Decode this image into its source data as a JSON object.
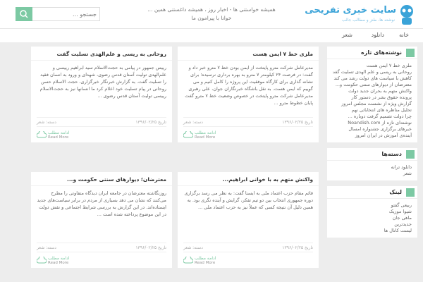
{
  "header": {
    "brand": "سایت خبری تفریحی",
    "brand_sub": "نوشته ها، طنز و مطالب جالب",
    "tagline_line1": "همیشه خواستنی ها - اخبار روز ، همیشه داغستنی همین ...",
    "tagline_line2": "خوانا با پیرامون ما",
    "search_placeholder": "جستجو ..."
  },
  "nav": {
    "items": [
      "خانه",
      "دانلود",
      "شعر"
    ]
  },
  "sidebar": {
    "recent_title": "نوشته‌های تازه",
    "recent_items": [
      "ملزی خط ۷ ایمن هست",
      "روحانی به ریسی و علم الهدی تسلیت گفت",
      "کاهش با سیاست های دولت رشد می کند",
      "معترضان از دیوارهای سنتی حکومت و...",
      "واکنش متهم به بحران جدید دولت",
      "پرونده حقوق بشر در دستور کار",
      "گزارش ویژه از نشست مجلس امروز",
      "تحلیل مناظره های انتخاباتی نهم",
      "چرا دولت تصمیم گرفت دوباره ...",
      "نوشته‌ای تازه از Noandish.com",
      "خبرهای برگزاری جشنواره امسال",
      "آینده‌ی آموزش در ایران امروز"
    ],
    "cats_title": "دسته‌ها",
    "cats_items": [
      "دانلود ترانه",
      "شعر"
    ],
    "links_title": "لینک",
    "links_items": [
      "ربیعی گفتو",
      "شیوا موزیک",
      "ماهی جان",
      "جدیدترین",
      "لیست کانال ها"
    ]
  },
  "posts": [
    {
      "title": "ملزی خط ۷ ایمن هست",
      "excerpt": "مدیرعامل شرکت مترو پایتخت از ایمن بودن خط ۷ مترو خبر داد و گفت: در فرصت ۲۴ کیلومتر ۷ مترو به بهره برداری نرسیده؛ برای نشانه گذاری برای کارگاه موفقیت این پروژه را کامل کنیم و می گوییم که ایمن هست. به نقل باشگاه خبرنگاران جوان، علی رهبری مدیرعامل شرکت مترو پایتخت در خصوص وضعیت خط ۷ مترو گفت پایان خطوط مترو ...",
      "date": "تاریخ ۱۳۹۶/۰۲/۲۵",
      "cat": "دسته: شعر",
      "read1": "ادامه مطلب",
      "read2": "Read More"
    },
    {
      "title": "روحانی به ریسی و علم‌الهدی تسلیت گفت",
      "excerpt": "رییس جمهور در پیامی به حجت‌الاسلام سید ابراهیم رییسی و علم‌الهدی تولیت آستان قدس رضوی، شهدای و ورود به انسان فقید را تسلیت گفت. به گزارش خبرنگار خبرگزاری، حجت الاسلام حسن روحانی در پیام تسلیت خود اعلام کرد ما انسانها نیز به حجت‌الاسلام رییسی تولیت آستان قدس رضوی ...",
      "date": "تاریخ ۱۳۹۶/۰۲/۲۵",
      "cat": "دسته: شعر",
      "read1": "ادامه مطلب",
      "read2": "Read More"
    },
    {
      "title": "واکنش متهم به با خوانی ابراهیم...",
      "excerpt": "قائم مقام حزب اعتماد ملی به ایسنا گفت: به نظر می رسد برگزاری دوره جمهوری انتخاب بین دو تیم تفکر، گرایش و آینده نگری بود. به همین دلیل آن نتیجه کسی که عملاً نیز به حزب اعتماد ملی ...",
      "date": "تاریخ ۱۳۹۶/۰۲/۲۵",
      "cat": "دسته: شعر",
      "read1": "ادامه مطلب",
      "read2": "Read More"
    },
    {
      "title": "معترضان؛ دیوارهای سنتی حکومت و...",
      "excerpt": "روزنگاشته معترضان در جامعه ایران دیدگاه متفاوتی را مطرح می‌کنند که نشان می دهد بسیاری از مردم در برابر سیاست‌های جدید ایستاده‌اند. در این گزارش به بررسی شرایط اجتماعی و نقش دولت در این موضوع پرداخته شده است ...",
      "date": "تاریخ ۱۳۹۶/۰۲/۲۵",
      "cat": "دسته: شعر",
      "read1": "ادامه مطلب",
      "read2": "Read More"
    }
  ],
  "colors": {
    "accent": "#7cc9a3",
    "brand": "#3aa3d8",
    "background": "#ededed"
  }
}
